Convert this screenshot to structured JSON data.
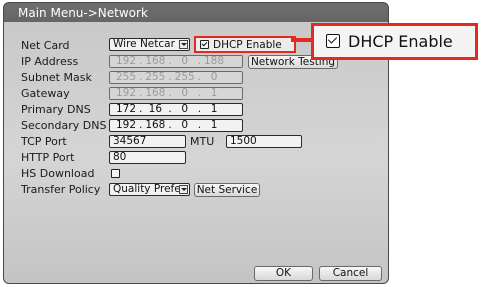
{
  "window": {
    "title": "Main Menu->Network"
  },
  "fields": {
    "net_card": {
      "label": "Net Card",
      "value": "Wire Netcar"
    },
    "dhcp": {
      "label": "DHCP Enable",
      "checked": true
    },
    "ip_address": {
      "label": "IP Address",
      "octets": [
        "192",
        "168",
        "0",
        "188"
      ]
    },
    "network_testing_button": "Network Testing",
    "subnet_mask": {
      "label": "Subnet Mask",
      "octets": [
        "255",
        "255",
        "255",
        "0"
      ]
    },
    "gateway": {
      "label": "Gateway",
      "octets": [
        "192",
        "168",
        "0",
        "1"
      ]
    },
    "primary_dns": {
      "label": "Primary DNS",
      "octets": [
        "172",
        "16",
        "0",
        "1"
      ]
    },
    "secondary_dns": {
      "label": "Secondary DNS",
      "octets": [
        "192",
        "168",
        "0",
        "1"
      ]
    },
    "tcp_port": {
      "label": "TCP Port",
      "value": "34567"
    },
    "mtu": {
      "label": "MTU",
      "value": "1500"
    },
    "http_port": {
      "label": "HTTP Port",
      "value": "80"
    },
    "hs_download": {
      "label": "HS Download",
      "checked": false
    },
    "transfer_policy": {
      "label": "Transfer Policy",
      "value": "Quality Prefe"
    },
    "net_service_button": "Net Service"
  },
  "buttons": {
    "ok": "OK",
    "cancel": "Cancel"
  },
  "callout": {
    "label": "DHCP Enable",
    "checked": true
  },
  "colors": {
    "highlight": "#e32a20"
  }
}
